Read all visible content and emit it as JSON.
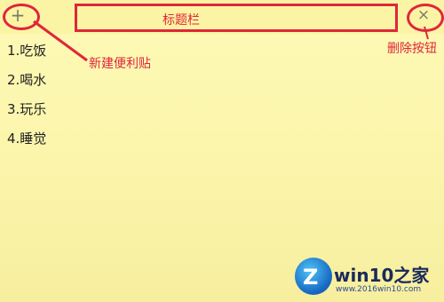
{
  "note": {
    "items": [
      "1.吃饭",
      "2.喝水",
      "3.玩乐",
      "4.睡觉"
    ]
  },
  "titlebar": {
    "add_icon": "plus-icon",
    "add_glyph": "+",
    "delete_icon": "close-icon",
    "delete_glyph": "×"
  },
  "annotations": {
    "title_bar_label": "标题栏",
    "new_note_label": "新建便利贴",
    "delete_button_label": "删除按钮",
    "color": "#e0263a"
  },
  "watermark": {
    "brand": "win10之家",
    "url": "www.2016win10.com"
  }
}
